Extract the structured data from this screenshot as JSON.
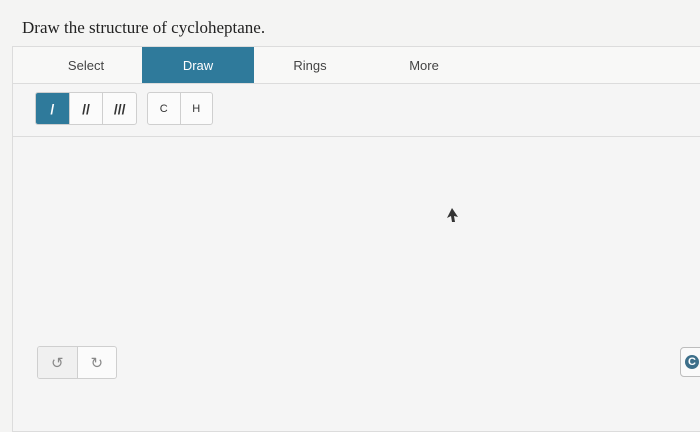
{
  "question": "Draw the structure of cycloheptane.",
  "tabs": [
    {
      "label": "Select",
      "active": false
    },
    {
      "label": "Draw",
      "active": true
    },
    {
      "label": "Rings",
      "active": false
    },
    {
      "label": "More",
      "active": false
    }
  ],
  "bonds": [
    {
      "label": "/",
      "name": "single-bond",
      "active": true
    },
    {
      "label": "//",
      "name": "double-bond",
      "active": false
    },
    {
      "label": "///",
      "name": "triple-bond",
      "active": false
    }
  ],
  "atoms": [
    "C",
    "H"
  ],
  "history": {
    "undo_glyph": "↺",
    "redo_glyph": "↻"
  },
  "edge_button_glyph": "C",
  "colors": {
    "accent": "#2f7a9b",
    "background": "#f4f4f3"
  }
}
